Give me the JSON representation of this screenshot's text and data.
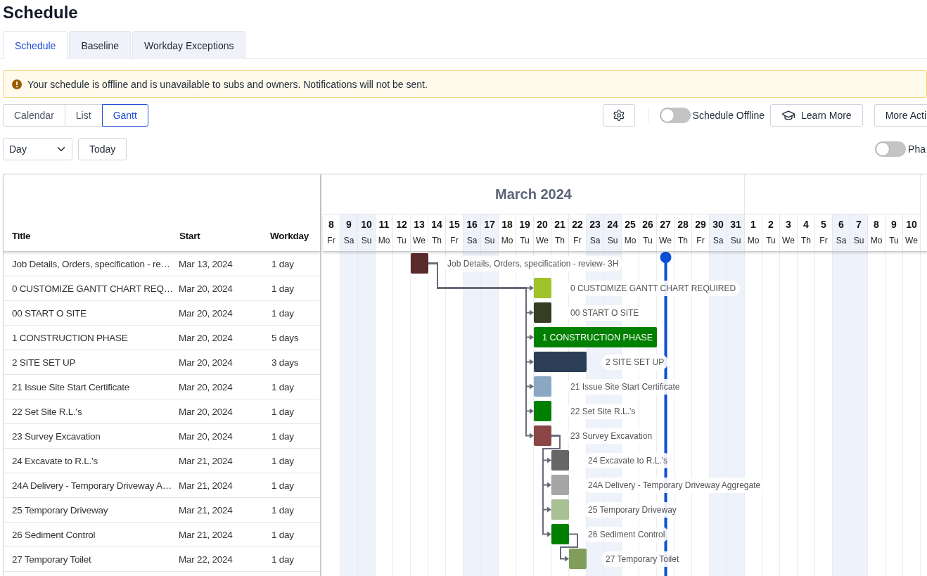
{
  "page_title": "Schedule",
  "tabs": [
    {
      "label": "Schedule",
      "selected": true
    },
    {
      "label": "Baseline",
      "selected": false
    },
    {
      "label": "Workday Exceptions",
      "selected": false
    }
  ],
  "alert": {
    "text": "Your schedule is offline and is unavailable to subs and owners. Notifications will not be sent."
  },
  "view_switch": [
    {
      "label": "Calendar",
      "selected": false
    },
    {
      "label": "List",
      "selected": false
    },
    {
      "label": "Gantt",
      "selected": true
    }
  ],
  "toolbar": {
    "schedule_offline": {
      "label": "Schedule Offline",
      "on": false
    },
    "learn_more": "Learn More",
    "more_actions": "More Acti"
  },
  "filters": {
    "zoom": "Day",
    "today_button": "Today",
    "phases": {
      "label": "Pha",
      "on": false
    }
  },
  "gantt": {
    "columns": [
      "Title",
      "Start",
      "Workday"
    ],
    "months": [
      {
        "label": "March 2024",
        "days": [
          {
            "day": "8",
            "dow": "Fr",
            "weekend": false,
            "today": false
          },
          {
            "day": "9",
            "dow": "Sa",
            "weekend": true,
            "today": false
          },
          {
            "day": "10",
            "dow": "Su",
            "weekend": true,
            "today": false
          },
          {
            "day": "11",
            "dow": "Mo",
            "weekend": false,
            "today": false
          },
          {
            "day": "12",
            "dow": "Tu",
            "weekend": false,
            "today": false
          },
          {
            "day": "13",
            "dow": "We",
            "weekend": false,
            "today": false
          },
          {
            "day": "14",
            "dow": "Th",
            "weekend": false,
            "today": false
          },
          {
            "day": "15",
            "dow": "Fr",
            "weekend": false,
            "today": false
          },
          {
            "day": "16",
            "dow": "Sa",
            "weekend": true,
            "today": false
          },
          {
            "day": "17",
            "dow": "Su",
            "weekend": true,
            "today": false
          },
          {
            "day": "18",
            "dow": "Mo",
            "weekend": false,
            "today": false
          },
          {
            "day": "19",
            "dow": "Tu",
            "weekend": false,
            "today": false
          },
          {
            "day": "20",
            "dow": "We",
            "weekend": false,
            "today": false
          },
          {
            "day": "21",
            "dow": "Th",
            "weekend": false,
            "today": false
          },
          {
            "day": "22",
            "dow": "Fr",
            "weekend": false,
            "today": false
          },
          {
            "day": "23",
            "dow": "Sa",
            "weekend": true,
            "today": false
          },
          {
            "day": "24",
            "dow": "Su",
            "weekend": true,
            "today": false
          },
          {
            "day": "25",
            "dow": "Mo",
            "weekend": false,
            "today": false
          },
          {
            "day": "26",
            "dow": "Tu",
            "weekend": false,
            "today": false
          },
          {
            "day": "27",
            "dow": "We",
            "weekend": false,
            "today": true
          },
          {
            "day": "28",
            "dow": "Th",
            "weekend": false,
            "today": false
          },
          {
            "day": "29",
            "dow": "Fr",
            "weekend": false,
            "today": false
          },
          {
            "day": "30",
            "dow": "Sa",
            "weekend": true,
            "today": false
          },
          {
            "day": "31",
            "dow": "Su",
            "weekend": true,
            "today": false
          }
        ]
      },
      {
        "days": [
          {
            "day": "1",
            "dow": "Mo",
            "weekend": false,
            "today": false
          },
          {
            "day": "2",
            "dow": "Tu",
            "weekend": false,
            "today": false
          },
          {
            "day": "3",
            "dow": "We",
            "weekend": false,
            "today": false
          },
          {
            "day": "4",
            "dow": "Th",
            "weekend": false,
            "today": false
          },
          {
            "day": "5",
            "dow": "Fr",
            "weekend": false,
            "today": false
          },
          {
            "day": "6",
            "dow": "Sa",
            "weekend": true,
            "today": false
          },
          {
            "day": "7",
            "dow": "Su",
            "weekend": true,
            "today": false
          },
          {
            "day": "8",
            "dow": "Mo",
            "weekend": false,
            "today": false
          },
          {
            "day": "9",
            "dow": "Tu",
            "weekend": false,
            "today": false
          },
          {
            "day": "10",
            "dow": "We",
            "weekend": false,
            "today": false
          }
        ]
      }
    ],
    "tasks": [
      {
        "title": "Job Details, Orders, specification - re…",
        "start": "Mar 13, 2024",
        "workdays": "1 day",
        "bar_label": "Job Details, Orders, specification - review- 3H",
        "color": "#5a2a2a",
        "label_inside": false
      },
      {
        "title": "0 CUSTOMIZE GANTT CHART REQ…",
        "start": "Mar 20, 2024",
        "workdays": "1 day",
        "bar_label": "0 CUSTOMIZE GANTT CHART REQUIRED",
        "color": "#9fc32a",
        "label_inside": false
      },
      {
        "title": "00 START O SITE",
        "start": "Mar 20, 2024",
        "workdays": "1 day",
        "bar_label": "00 START O SITE",
        "color": "#353d25",
        "label_inside": false
      },
      {
        "title": "1 CONSTRUCTION PHASE",
        "start": "Mar 20, 2024",
        "workdays": "5 days",
        "bar_label": "1 CONSTRUCTION PHASE",
        "color": "#008000",
        "label_inside": true
      },
      {
        "title": "2 SITE SET UP",
        "start": "Mar 20, 2024",
        "workdays": "3 days",
        "bar_label": "2 SITE SET UP",
        "color": "#2c3e55",
        "label_inside": false
      },
      {
        "title": "21 Issue Site Start Certificate",
        "start": "Mar 20, 2024",
        "workdays": "1 day",
        "bar_label": "21 Issue Site Start Certificate",
        "color": "#8aa8c4",
        "label_inside": false
      },
      {
        "title": "22 Set Site R.L.'s",
        "start": "Mar 20, 2024",
        "workdays": "1 day",
        "bar_label": "22 Set Site R.L.'s",
        "color": "#008000",
        "label_inside": false
      },
      {
        "title": "23 Survey Excavation",
        "start": "Mar 20, 2024",
        "workdays": "1 day",
        "bar_label": "23 Survey Excavation",
        "color": "#8b4545",
        "label_inside": false
      },
      {
        "title": "24 Excavate to R.L.'s",
        "start": "Mar 21, 2024",
        "workdays": "1 day",
        "bar_label": "24 Excavate to R.L.'s",
        "color": "#666666",
        "label_inside": false
      },
      {
        "title": "24A Delivery - Temporary Driveway A…",
        "start": "Mar 21, 2024",
        "workdays": "1 day",
        "bar_label": "24A Delivery - Temporary Driveway Aggregate",
        "color": "#a6a6a6",
        "label_inside": false
      },
      {
        "title": "25 Temporary Driveway",
        "start": "Mar 21, 2024",
        "workdays": "1 day",
        "bar_label": "25 Temporary Driveway",
        "color": "#a9bf94",
        "label_inside": false
      },
      {
        "title": "26 Sediment Control",
        "start": "Mar 21, 2024",
        "workdays": "1 day",
        "bar_label": "26 Sediment Control",
        "color": "#008000",
        "label_inside": false
      },
      {
        "title": "27 Temporary Toilet",
        "start": "Mar 22, 2024",
        "workdays": "1 day",
        "bar_label": "27 Temporary Toilet",
        "color": "#7f9e5a",
        "label_inside": false
      }
    ]
  }
}
